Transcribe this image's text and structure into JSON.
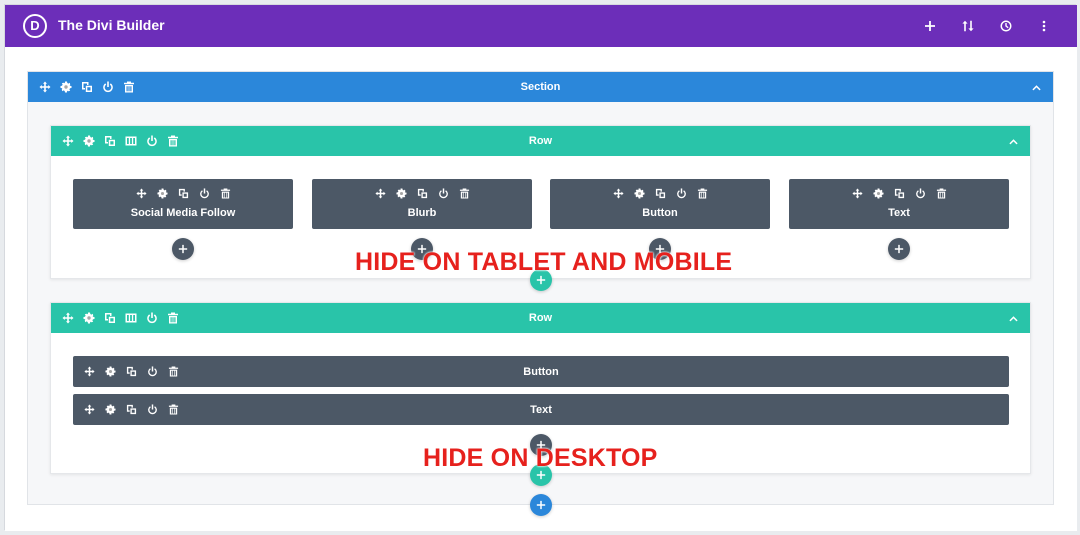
{
  "app": {
    "logo_letter": "D",
    "title": "The Divi Builder",
    "actions": [
      "add-icon",
      "sort-icon",
      "history-icon",
      "more-icon"
    ]
  },
  "section": {
    "label": "Section",
    "color": "#2b87da",
    "toolbar_icons": [
      "move-icon",
      "settings-icon",
      "duplicate-icon",
      "power-icon",
      "delete-icon"
    ]
  },
  "rows": [
    {
      "label": "Row",
      "color": "#29c4a9",
      "toolbar_icons": [
        "move-icon",
        "settings-icon",
        "duplicate-icon",
        "columns-icon",
        "power-icon",
        "delete-icon"
      ],
      "modules": [
        "Social Media Follow",
        "Blurb",
        "Button",
        "Text"
      ]
    },
    {
      "label": "Row",
      "color": "#29c4a9",
      "toolbar_icons": [
        "move-icon",
        "settings-icon",
        "duplicate-icon",
        "columns-icon",
        "power-icon",
        "delete-icon"
      ],
      "modules": [
        "Button",
        "Text"
      ]
    }
  ],
  "module_icons": [
    "move-icon",
    "settings-icon",
    "duplicate-icon",
    "power-icon",
    "delete-icon"
  ],
  "annotations": {
    "row1_note": "HIDE ON TABLET AND MOBILE",
    "row2_note": "HIDE ON DESKTOP"
  },
  "colors": {
    "topbar": "#6c2eb9",
    "module": "#4c5866",
    "annotation": "#e6211d"
  }
}
